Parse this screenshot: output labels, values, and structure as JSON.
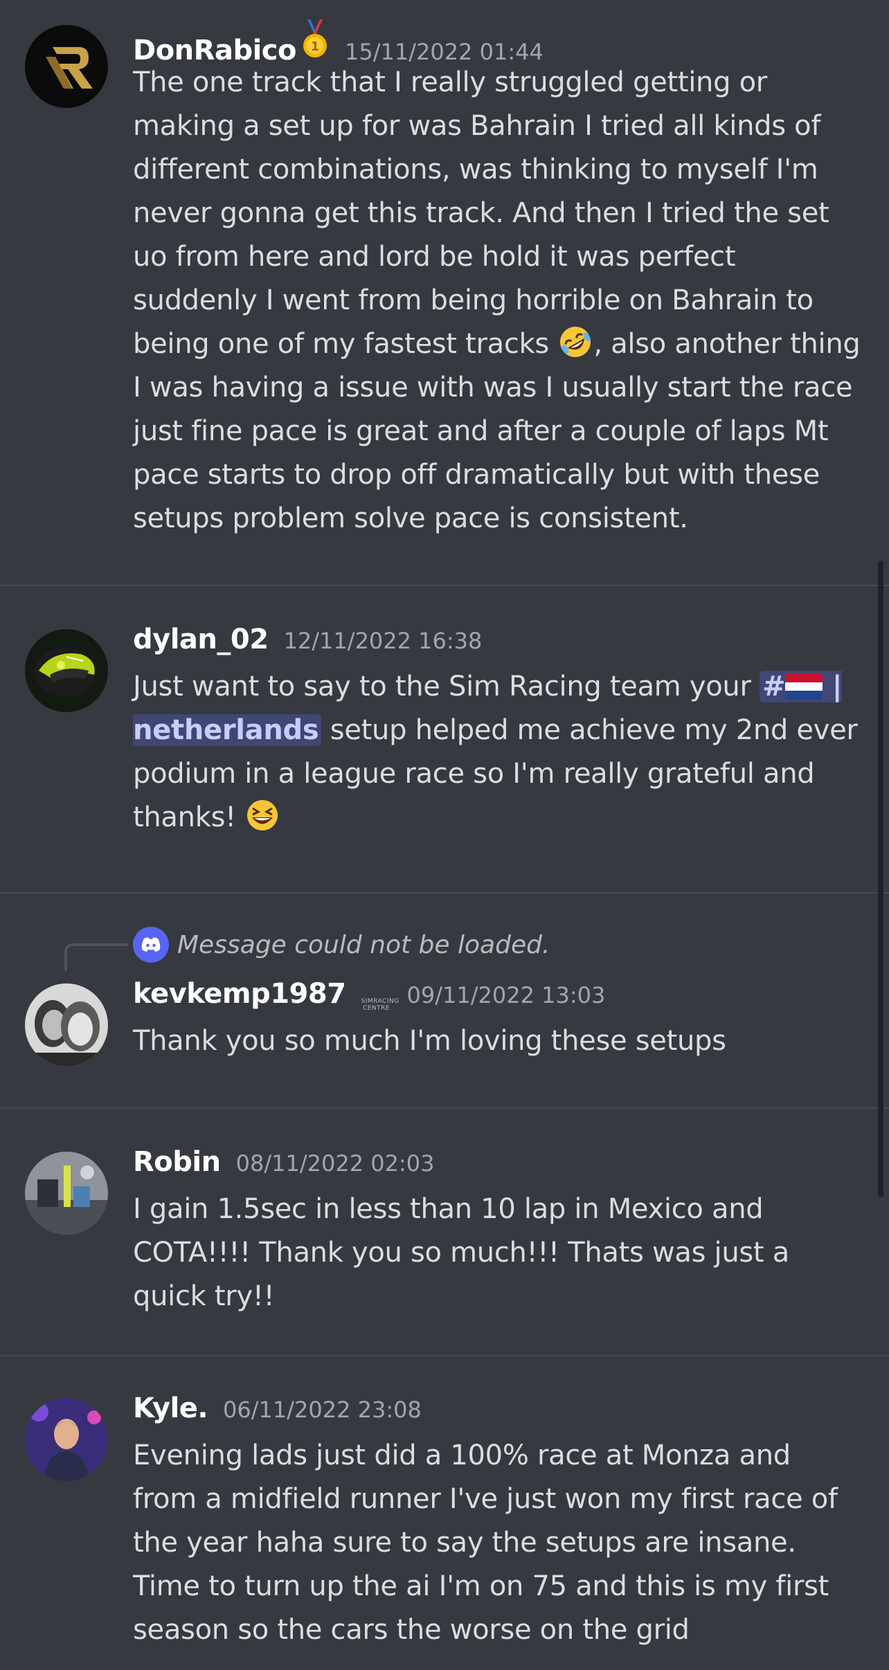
{
  "messages": [
    {
      "username": "DonRabico",
      "badge_icon": "first-place-medal-icon",
      "timestamp": "15/11/2022 01:44",
      "text_part1": "The one track that I really struggled getting or making a set up for was Bahrain I tried all kinds of different combinations, was thinking to myself I'm never gonna get this track. And then I tried the set uo from here and lord be hold it was perfect suddenly I went from being horrible on Bahrain to being one of my fastest tracks",
      "emoji1": "rolling-on-floor-laughing-emoji",
      "text_part2": ", also another thing I was having a issue with was I usually start the race just fine pace is great and after a couple of laps Mt pace starts to drop off dramatically but with these setups problem solve pace is consistent."
    },
    {
      "username": "dylan_02",
      "timestamp": "12/11/2022 16:38",
      "text_part1": "Just want to say to the Sim Racing team your ",
      "channel_mention_hash": "#",
      "channel_mention_name": "| netherlands",
      "text_part2": " setup helped me achieve my 2nd ever podium in a league race so I'm really grateful and thanks! ",
      "emoji1": "grinning-squinting-face-emoji"
    },
    {
      "reply_text": "Message could not be loaded.",
      "username": "kevkemp1987",
      "badge_text": "SIMRACING CENTRE",
      "timestamp": "09/11/2022 13:03",
      "text": "Thank you so much I'm loving these setups"
    },
    {
      "username": "Robin",
      "timestamp": "08/11/2022 02:03",
      "text": "I gain 1.5sec in less than 10 lap in Mexico and COTA!!!! Thank you so much!!! Thats was just a quick try!!"
    },
    {
      "username": "Kyle.",
      "timestamp": "06/11/2022 23:08",
      "text": "Evening lads just did a 100% race at Monza and from a midfield runner I've just won my first race of the year haha sure to say the setups are insane. Time to turn up the ai I'm on 75 and this is my first season so the cars the worse on the grid"
    }
  ],
  "colors": {
    "background": "#36393f",
    "username": "#ffffff",
    "timestamp": "#a3a6aa",
    "text": "#dcddde",
    "mention_bg": "#414675",
    "mention_text": "#c9cdfb",
    "discord_blurple": "#5865f2"
  }
}
